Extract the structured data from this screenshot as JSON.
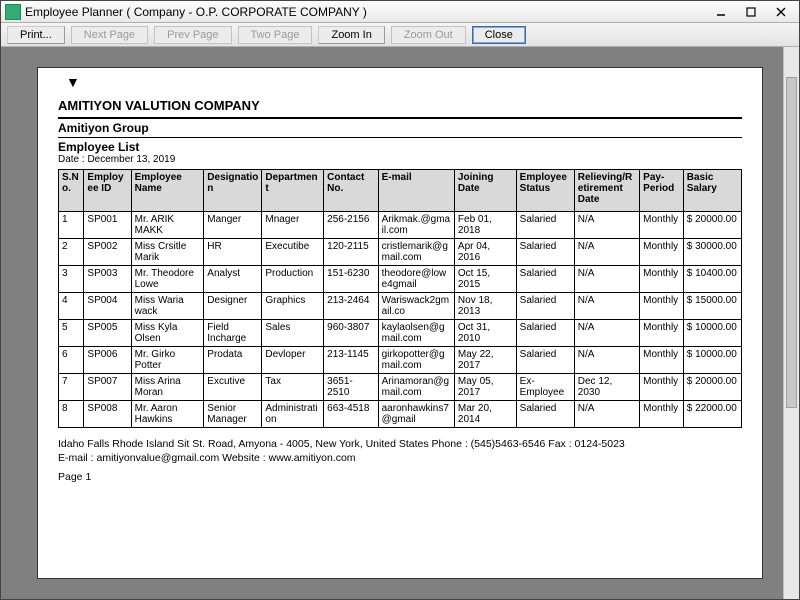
{
  "window": {
    "title": "Employee Planner ( Company - O.P. CORPORATE COMPANY )"
  },
  "toolbar": {
    "print": "Print...",
    "next": "Next Page",
    "prev": "Prev Page",
    "two": "Two Page",
    "zin": "Zoom In",
    "zout": "Zoom Out",
    "close": "Close"
  },
  "report": {
    "company": "AMITIYON VALUTION COMPANY",
    "group": "Amitiyon Group",
    "section": "Employee List",
    "date_label": "Date :  December 13, 2019",
    "headers": {
      "sno": "S.No.",
      "empid": "Employee ID",
      "name": "Employee Name",
      "desig": "Designation",
      "dept": "Department",
      "contact": "Contact No.",
      "email": "E-mail",
      "joining": "Joining Date",
      "status": "Employee Status",
      "relieving": "Relieving/Retirement Date",
      "payperiod": "Pay-Period",
      "salary": "Basic Salary"
    },
    "rows": [
      {
        "sno": "1",
        "empid": "SP001",
        "name": "Mr. ARIK MAKK",
        "desig": "Manger",
        "dept": "Mnager",
        "contact": "256-2156",
        "email": "Arikmak.@gmail.com",
        "joining": "Feb 01, 2018",
        "status": "Salaried",
        "relieving": "N/A",
        "payperiod": "Monthly",
        "salary": "$ 20000.00"
      },
      {
        "sno": "2",
        "empid": "SP002",
        "name": "Miss Crsitle Marik",
        "desig": "HR",
        "dept": "Executibe",
        "contact": "120-2115",
        "email": "cristlemarik@gmail.com",
        "joining": "Apr 04, 2016",
        "status": "Salaried",
        "relieving": "N/A",
        "payperiod": "Monthly",
        "salary": "$ 30000.00"
      },
      {
        "sno": "3",
        "empid": "SP003",
        "name": "Mr. Theodore Lowe",
        "desig": "Analyst",
        "dept": "Production",
        "contact": "151-6230",
        "email": "theodore@lowe4gmail",
        "joining": "Oct 15, 2015",
        "status": "Salaried",
        "relieving": "N/A",
        "payperiod": "Monthly",
        "salary": "$ 10400.00"
      },
      {
        "sno": "4",
        "empid": "SP004",
        "name": "Miss Waria wack",
        "desig": "Designer",
        "dept": "Graphics",
        "contact": "213-2464",
        "email": "Wariswack2gmail.co",
        "joining": "Nov 18, 2013",
        "status": "Salaried",
        "relieving": "N/A",
        "payperiod": "Monthly",
        "salary": "$ 15000.00"
      },
      {
        "sno": "5",
        "empid": "SP005",
        "name": "Miss Kyla Olsen",
        "desig": "Field Incharge",
        "dept": "Sales",
        "contact": "960-3807",
        "email": "kaylaolsen@gmail.com",
        "joining": "Oct 31, 2010",
        "status": "Salaried",
        "relieving": "N/A",
        "payperiod": "Monthly",
        "salary": "$ 10000.00"
      },
      {
        "sno": "6",
        "empid": "SP006",
        "name": "Mr. Girko Potter",
        "desig": "Prodata",
        "dept": "Devloper",
        "contact": "213-1145",
        "email": "girkopotter@gmail.com",
        "joining": "May 22, 2017",
        "status": "Salaried",
        "relieving": "N/A",
        "payperiod": "Monthly",
        "salary": "$ 10000.00"
      },
      {
        "sno": "7",
        "empid": "SP007",
        "name": "Miss Arina Moran",
        "desig": "Excutive",
        "dept": "Tax",
        "contact": "3651-2510",
        "email": "Arinamoran@gmail.com",
        "joining": "May 05, 2017",
        "status": "Ex-Employee",
        "relieving": "Dec 12, 2030",
        "payperiod": "Monthly",
        "salary": "$ 20000.00"
      },
      {
        "sno": "8",
        "empid": "SP008",
        "name": "Mr. Aaron Hawkins",
        "desig": "Senior Manager",
        "dept": "Administration",
        "contact": "663-4518",
        "email": "aaronhawkins7@gmail",
        "joining": "Mar 20, 2014",
        "status": "Salaried",
        "relieving": "N/A",
        "payperiod": "Monthly",
        "salary": "$ 22000.00"
      }
    ],
    "footer_line1": "Idaho Falls Rhode Island  Sit St. Road, Amyona - 4005, New York, United States Phone : (545)5463-6546   Fax : 0124-5023",
    "footer_line2": "E-mail : amitiyonvalue@gmail.com  Website : www.amitiyon.com",
    "page": "Page 1"
  }
}
